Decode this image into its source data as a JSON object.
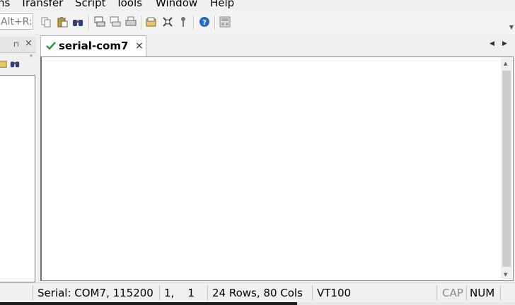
{
  "menu": {
    "items": [
      {
        "label": "ns"
      },
      {
        "label": "Transfer"
      },
      {
        "label": "Script"
      },
      {
        "label": "Tools"
      },
      {
        "label": "Window"
      },
      {
        "label": "Help"
      }
    ]
  },
  "toolbar": {
    "connect_field": "Alt+R:",
    "icons": [
      "copy-icon",
      "paste-icon",
      "find-icon",
      "print-screen-icon",
      "print-selection-icon",
      "print-icon",
      "session-options-icon",
      "global-options-icon",
      "keymap-icon",
      "help-icon",
      "keypad-icon"
    ]
  },
  "session_pane": {
    "pin_glyph": "⊓",
    "close_glyph": "×"
  },
  "tabs": [
    {
      "label": "serial-com7",
      "status": "connected",
      "close_glyph": "×"
    }
  ],
  "tab_nav": {
    "left": "◀",
    "right": "▶"
  },
  "status_bar": {
    "connection": "Serial: COM7, 115200",
    "cursor": "1,    1",
    "size": "24 Rows, 80 Cols",
    "emulation": "VT100",
    "cap": "CAP",
    "num": "NUM"
  },
  "colors": {
    "accent_check": "#2f9a3b",
    "help_blue": "#2a66c8"
  }
}
